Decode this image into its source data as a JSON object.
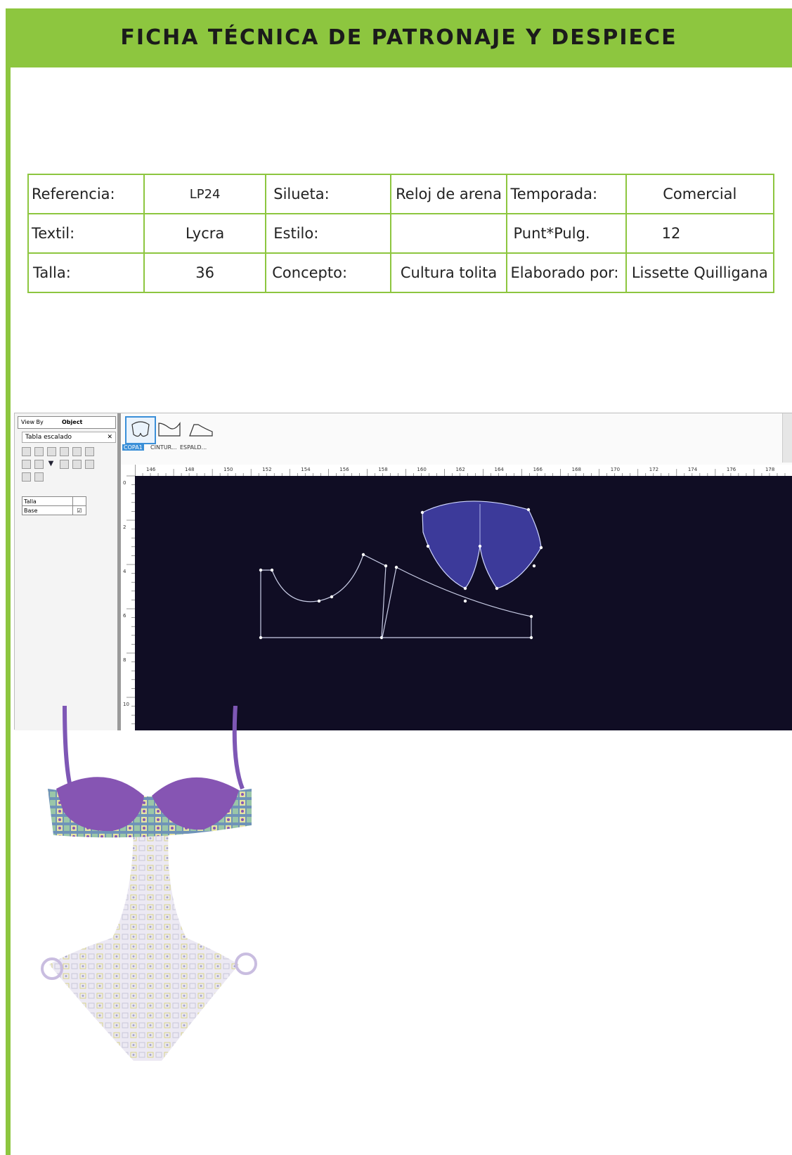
{
  "header": {
    "title": "FICHA TÉCNICA DE PATRONAJE Y DESPIECE"
  },
  "spec": {
    "rows": [
      [
        "Referencia:",
        "LP24",
        "Silueta:",
        "Reloj de arena",
        "Temporada:",
        "Comercial"
      ],
      [
        "Textil:",
        "Lycra",
        "Estilo:",
        "",
        "Punt*Pulg.",
        "12"
      ],
      [
        "Talla:",
        "36",
        "Concepto:",
        "Cultura tolita",
        "Elaborado por:",
        "Lissette Quilligana"
      ]
    ]
  },
  "cad": {
    "view_by_label": "View By",
    "view_by_value": "Object",
    "panel_title": "Tabla escalado",
    "size_table": {
      "header": "Talla",
      "row": "Base"
    },
    "pieces": [
      "COPA1",
      "CINTUR...",
      "ESPALD..."
    ],
    "top_ruler": [
      "146",
      "148",
      "150",
      "152",
      "154",
      "156",
      "158",
      "160",
      "162",
      "164",
      "166",
      "168",
      "170",
      "172",
      "174",
      "176",
      "178"
    ],
    "left_ruler": [
      "0",
      "2",
      "4",
      "6",
      "8",
      "10"
    ],
    "colors": {
      "canvas": "#100d24",
      "cup": "#3c3a9a",
      "accent": "#3a8fd8"
    }
  },
  "garment": {
    "colors": {
      "cups": "#8655b3",
      "straps": "#7e57b5",
      "pattern_accent": "#e5e3a3"
    }
  },
  "colors": {
    "brand_green": "#8dc63f"
  }
}
